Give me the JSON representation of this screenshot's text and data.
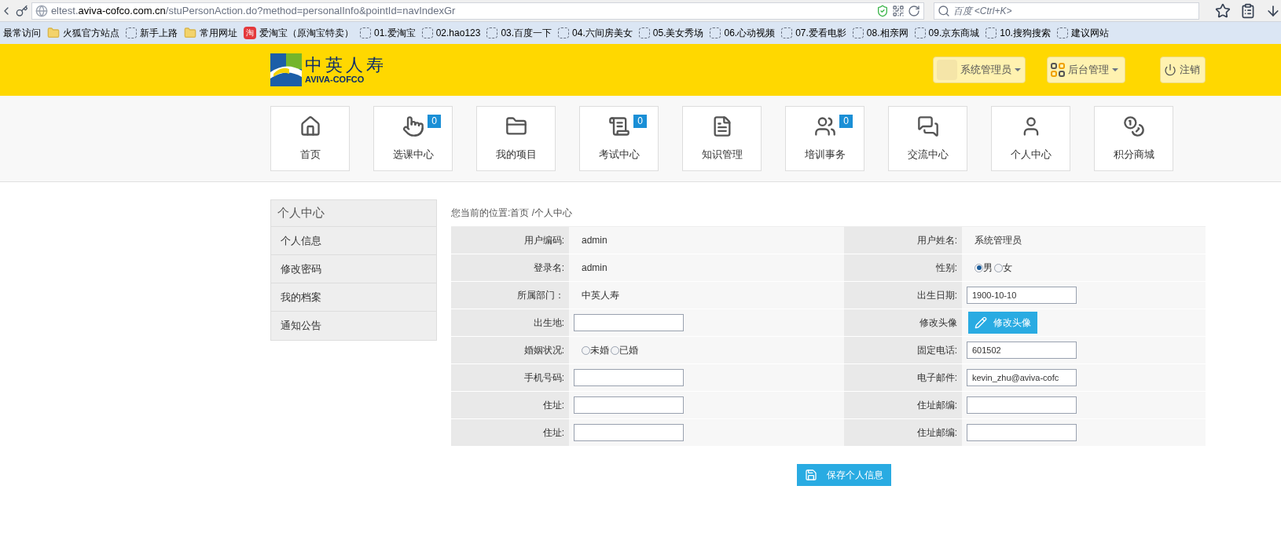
{
  "browser": {
    "url": {
      "prefix": "eltest.",
      "domain": "aviva-cofco.com.cn",
      "path": "/stuPersonAction.do?method=personalInfo&pointId=navIndexGr"
    },
    "search": {
      "placeholder": "百度 <Ctrl+K>"
    },
    "bookmarks": [
      {
        "kind": "plain",
        "label": "最常访问"
      },
      {
        "kind": "folder",
        "label": "火狐官方站点"
      },
      {
        "kind": "page",
        "label": "新手上路"
      },
      {
        "kind": "folder",
        "label": "常用网址"
      },
      {
        "kind": "taobao",
        "label": "爱淘宝（原淘宝特卖）",
        "icon_text": "淘"
      },
      {
        "kind": "page",
        "label": "01.爱淘宝"
      },
      {
        "kind": "page",
        "label": "02.hao123"
      },
      {
        "kind": "page",
        "label": "03.百度一下"
      },
      {
        "kind": "page",
        "label": "04.六间房美女"
      },
      {
        "kind": "page",
        "label": "05.美女秀场"
      },
      {
        "kind": "page",
        "label": "06.心动视频"
      },
      {
        "kind": "page",
        "label": "07.爱看电影"
      },
      {
        "kind": "page",
        "label": "08.相亲网"
      },
      {
        "kind": "page",
        "label": "09.京东商城"
      },
      {
        "kind": "page",
        "label": "10.搜狗搜索"
      },
      {
        "kind": "page",
        "label": "建议网站"
      }
    ]
  },
  "header": {
    "logo": {
      "chinese": "中英人寿",
      "english": "AVIVA-COFCO"
    },
    "user_menu": "系统管理员",
    "admin_menu": "后台管理",
    "logout": "注销"
  },
  "nav": [
    {
      "label": "首页"
    },
    {
      "label": "选课中心",
      "badge": "0"
    },
    {
      "label": "我的项目"
    },
    {
      "label": "考试中心",
      "badge": "0"
    },
    {
      "label": "知识管理"
    },
    {
      "label": "培训事务",
      "badge": "0"
    },
    {
      "label": "交流中心"
    },
    {
      "label": "个人中心"
    },
    {
      "label": "积分商城"
    }
  ],
  "sidebar": {
    "title": "个人中心",
    "items": [
      "个人信息",
      "修改密码",
      "我的档案",
      "通知公告"
    ]
  },
  "breadcrumb": "您当前的位置:首页 /个人中心",
  "form": {
    "rows": [
      {
        "left": {
          "label": "用户编码:",
          "kind": "text",
          "value": "admin"
        },
        "right": {
          "label": "用户姓名:",
          "kind": "text",
          "value": "系统管理员"
        }
      },
      {
        "left": {
          "label": "登录名:",
          "kind": "text",
          "value": "admin"
        },
        "right": {
          "label": "性别:",
          "kind": "radio",
          "options": [
            {
              "label": "男",
              "selected": true
            },
            {
              "label": "女",
              "selected": false
            }
          ]
        }
      },
      {
        "left": {
          "label": "所属部门：",
          "kind": "text",
          "value": "中英人寿"
        },
        "right": {
          "label": "出生日期:",
          "kind": "input",
          "value": "1900-10-10"
        }
      },
      {
        "left": {
          "label": "出生地:",
          "kind": "input"
        },
        "right": {
          "label": "修改头像",
          "kind": "button",
          "value": "修改头像"
        }
      },
      {
        "left": {
          "label": "婚姻状况:",
          "kind": "radio",
          "options": [
            {
              "label": "未婚",
              "selected": false
            },
            {
              "label": "已婚",
              "selected": false
            }
          ]
        },
        "right": {
          "label": "固定电话:",
          "kind": "input",
          "value": "601502"
        }
      },
      {
        "left": {
          "label": "手机号码:",
          "kind": "input"
        },
        "right": {
          "label": "电子邮件:",
          "kind": "input",
          "value": "kevin_zhu@aviva-cofc"
        }
      },
      {
        "left": {
          "label": "住址:",
          "kind": "input"
        },
        "right": {
          "label": "住址邮编:",
          "kind": "input"
        }
      },
      {
        "left": {
          "label": "住址:",
          "kind": "input"
        },
        "right": {
          "label": "住址邮编:",
          "kind": "input"
        }
      }
    ]
  },
  "save_button": "保存个人信息"
}
